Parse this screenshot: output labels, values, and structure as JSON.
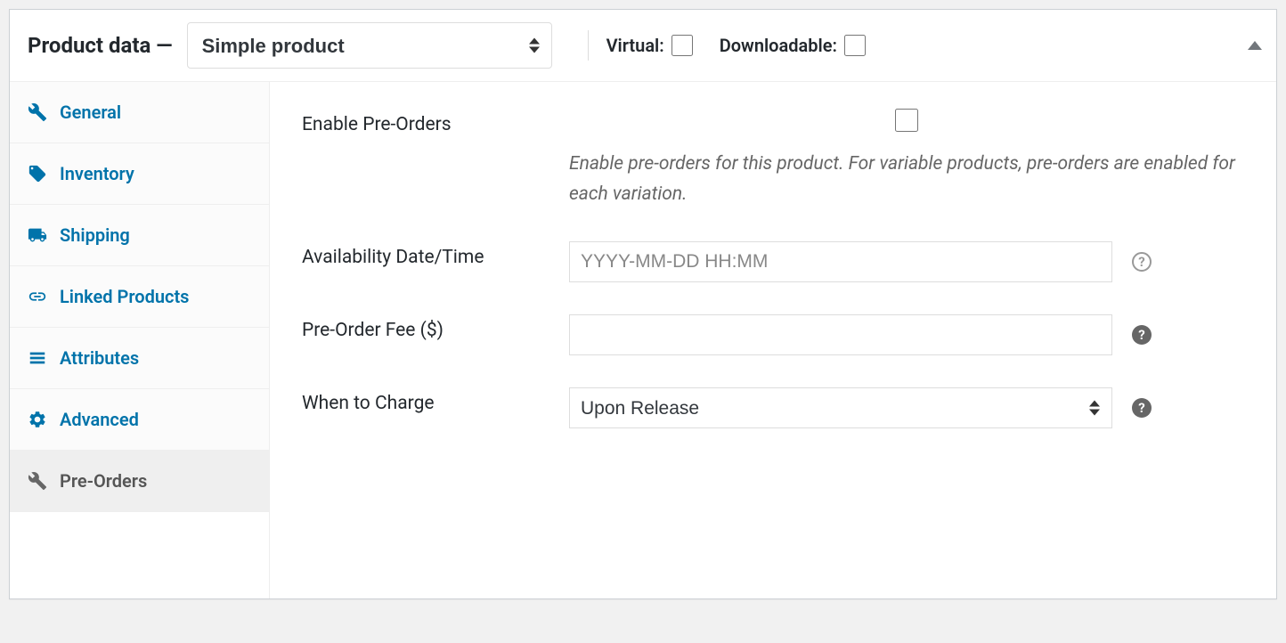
{
  "header": {
    "title": "Product data —",
    "product_type": "Simple product",
    "virtual_label": "Virtual:",
    "downloadable_label": "Downloadable:"
  },
  "sidebar": {
    "items": [
      {
        "label": "General"
      },
      {
        "label": "Inventory"
      },
      {
        "label": "Shipping"
      },
      {
        "label": "Linked Products"
      },
      {
        "label": "Attributes"
      },
      {
        "label": "Advanced"
      },
      {
        "label": "Pre-Orders"
      }
    ]
  },
  "form": {
    "enable": {
      "label": "Enable Pre-Orders",
      "description": "Enable pre-orders for this product. For variable products, pre-orders are enabled for each variation."
    },
    "availability": {
      "label": "Availability Date/Time",
      "placeholder": "YYYY-MM-DD HH:MM",
      "value": ""
    },
    "fee": {
      "label": "Pre-Order Fee ($)",
      "value": ""
    },
    "charge": {
      "label": "When to Charge",
      "selected": "Upon Release"
    }
  }
}
